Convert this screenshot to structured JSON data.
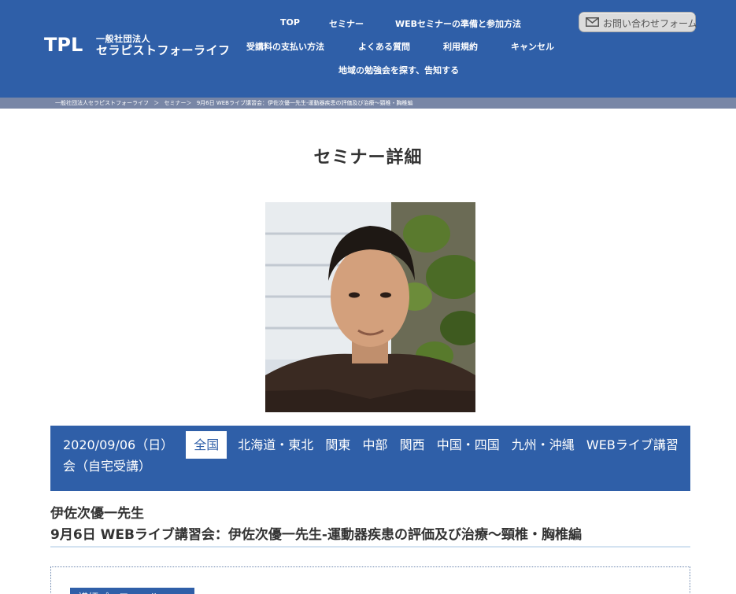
{
  "header": {
    "logo_mark": "TPL",
    "logo_sub": "一般社団法人",
    "logo_name": "セラピストフォーライフ",
    "nav": {
      "top": "TOP",
      "seminar": "セミナー",
      "web_prep": "WEBセミナーの準備と参加方法",
      "payment": "受講料の支払い方法",
      "faq": "よくある質問",
      "terms": "利用規約",
      "cancel": "キャンセル",
      "study": "地域の勉強会を探す、告知する"
    },
    "contact_label": "お問い合わせフォーム",
    "contact_icon": "mail-icon"
  },
  "breadcrumb": {
    "items": [
      "一般社団法人セラピストフォーライフ",
      "＞",
      "セミナー＞",
      "9月6日 WEBライブ講習会：伊佐次優一先生-運動器疾患の評価及び治療〜頸椎・胸椎編"
    ]
  },
  "page_title": "セミナー詳細",
  "info": {
    "date": "2020/09/06（日）",
    "regions": [
      "全国",
      "北海道・東北",
      "関東",
      "中部",
      "関西",
      "中国・四国",
      "九州・沖縄"
    ],
    "category": "WEBライブ講習会（自宅受講）"
  },
  "teacher": "伊佐次優一先生",
  "seminar_title": "9月6日 WEBライブ講習会：伊佐次優一先生-運動器疾患の評価及び治療〜頸椎・胸椎編",
  "detail_tab": "講師プロフィール",
  "colors": {
    "brand": "#2f5fa8",
    "breadcrumb_bg": "#7886a6",
    "rule": "#d4e3f1"
  }
}
